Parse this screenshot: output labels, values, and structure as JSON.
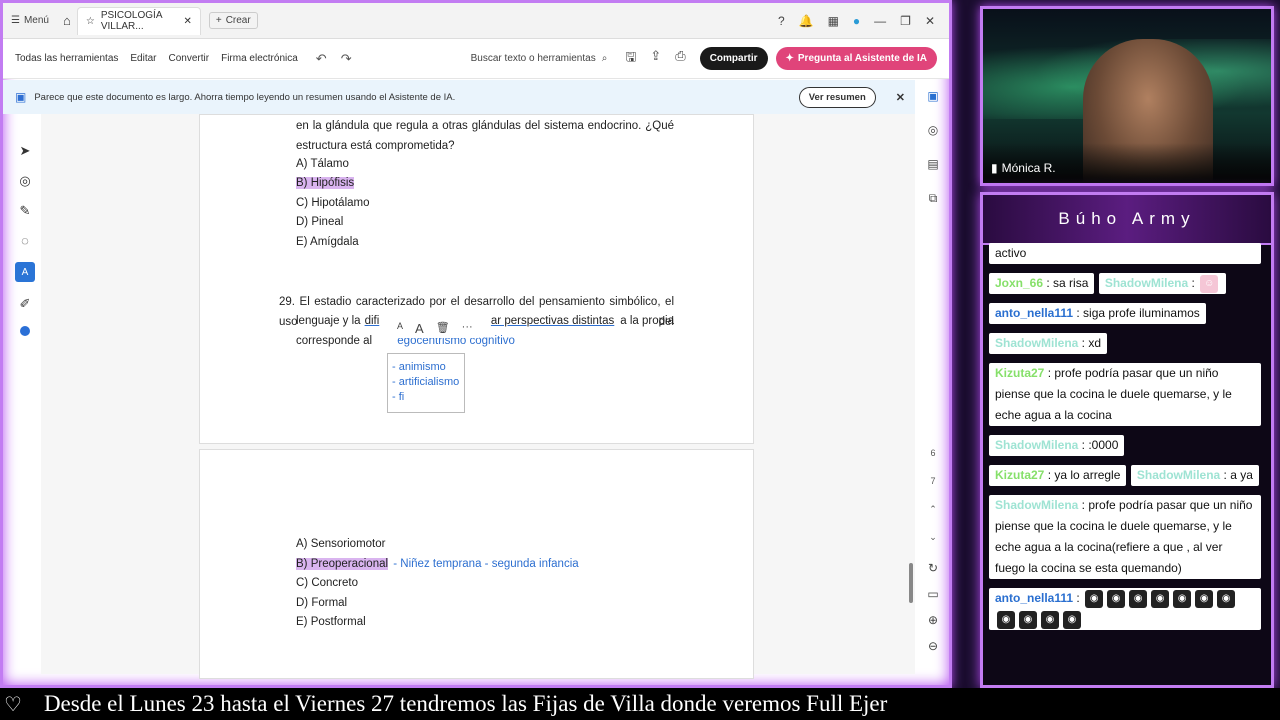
{
  "browser": {
    "menu_label": "Menú",
    "tab_title": "PSICOLOGÍA VILLAR...",
    "new_tab_label": "Crear"
  },
  "toolbar": {
    "all_tools": "Todas las herramientas",
    "edit": "Editar",
    "convert": "Convertir",
    "esign": "Firma electrónica",
    "search_placeholder": "Buscar texto o herramientas",
    "share": "Compartir",
    "ai_assistant": "Pregunta al Asistente de IA"
  },
  "banner": {
    "text": "Parece que este documento es largo. Ahorra tiempo leyendo un resumen usando el Asistente de IA.",
    "button": "Ver resumen"
  },
  "question28": {
    "line1": "en la glándula que regula a otras glándulas del sistema endocrino. ¿Qué",
    "line2": "estructura está comprometida?",
    "options": [
      "A)  Tálamo",
      "B)  Hipófisis",
      "C)  Hipotálamo",
      "D)  Pineal",
      "E)  Amígdala"
    ]
  },
  "question29": {
    "line1": "29. El estadio caracterizado por el desarrollo del pensamiento simbólico, el uso del",
    "line2_a": "lenguaje y la",
    "line2_b": "difi",
    "line2_c": "ar perspectivas distintas",
    "line2_d": "a la propia",
    "line3_a": "corresponde al",
    "line3_b": "egocentrismo cognitivo",
    "note_lines": [
      "- animismo",
      "- artificialismo",
      "- fi"
    ],
    "options": [
      "A)  Sensoriomotor",
      "B)  Preoperacional",
      "C)  Concreto",
      "D)  Formal",
      "E)  Postformal"
    ],
    "annotation": "- Niñez temprana - segunda infancia"
  },
  "pages": {
    "current": "6",
    "next": "7"
  },
  "ticker": "Desde el Lunes 23 hasta el Viernes 27 tendremos las Fijas de Villa donde veremos Full Ejer",
  "webcam": {
    "name": "Mónica R."
  },
  "chat": {
    "title": "Búho Army",
    "messages": [
      {
        "user": "",
        "text": "activo"
      },
      {
        "user": "Joxn_66",
        "text": " : sa risa"
      },
      {
        "user": "ShadowMilena",
        "text": " :"
      },
      {
        "user": "anto_nella111",
        "text": " : siga profe iluminamos"
      },
      {
        "user": "ShadowMilena",
        "text": " : xd"
      },
      {
        "user": "Kizuta27",
        "text": " : profe podría pasar que un niño piense que la cocina le duele quemarse, y le eche agua a la cocina"
      },
      {
        "user": "ShadowMilena",
        "text": " : :0000"
      },
      {
        "user": "Kizuta27",
        "text": " : ya lo arregle"
      },
      {
        "user": "ShadowMilena",
        "text": " : a ya"
      },
      {
        "user": "ShadowMilena",
        "text": " : profe podría pasar que un niño piense que la cocina le duele quemarse, y le eche agua a la cocina(refiere a que , al ver fuego la cocina se esta quemando)"
      },
      {
        "user": "anto_nella111",
        "text": " :"
      }
    ]
  }
}
